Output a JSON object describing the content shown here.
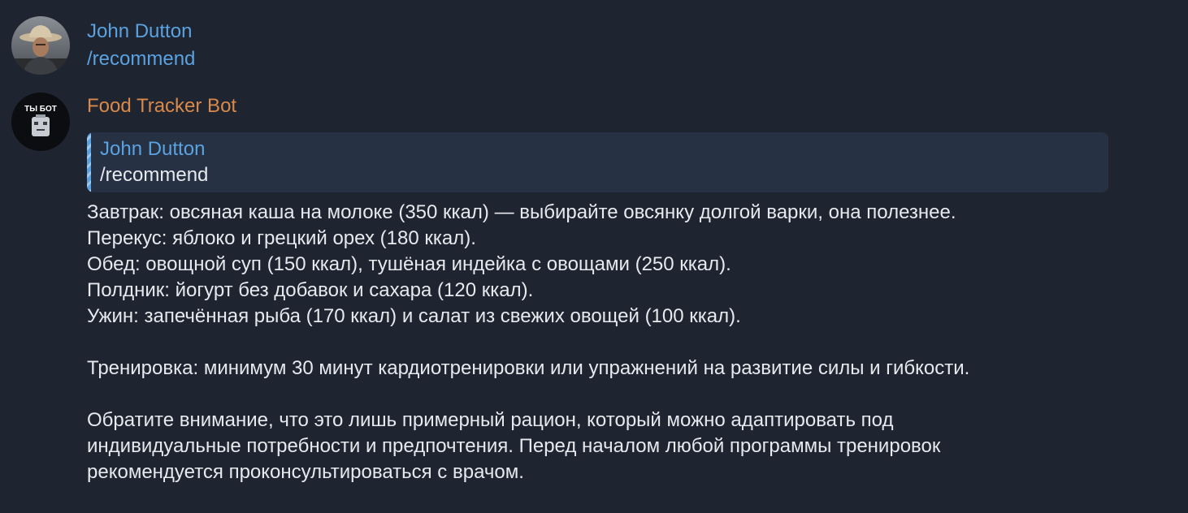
{
  "messages": {
    "user": {
      "sender": "John Dutton",
      "text": "/recommend",
      "avatar_icon": "person-cowboy-hat-avatar"
    },
    "bot": {
      "sender": "Food Tracker Bot",
      "avatar_icon": "bot-avatar",
      "avatar_label": "ТЫ БОТ",
      "reply": {
        "sender": "John Dutton",
        "text": "/recommend"
      },
      "lines": [
        "Завтрак: овсяная каша на молоке (350 ккал) — выбирайте овсянку долгой варки, она полезнее.",
        "Перекус: яблоко и грецкий орех (180 ккал).",
        "Обед: овощной суп (150 ккал), тушёная индейка с овощами (250 ккал).",
        "Полдник: йогурт без добавок и сахара (120 ккал).",
        "Ужин: запечённая рыба (170 ккал) и салат из свежих овощей (100 ккал).",
        "Тренировка: минимум 30 минут кардиотренировки или упражнений на развитие силы и гибкости.",
        "Обратите внимание, что это лишь примерный рацион, который можно адаптировать под",
        "индивидуальные потребности и предпочтения. Перед началом любой программы тренировок",
        "рекомендуется проконсультироваться с врачом."
      ]
    }
  },
  "colors": {
    "background": "#1e2430",
    "user_name": "#5aa2e0",
    "bot_name": "#d9894a",
    "reply_bg": "#263244",
    "text": "#e6e9ee"
  }
}
